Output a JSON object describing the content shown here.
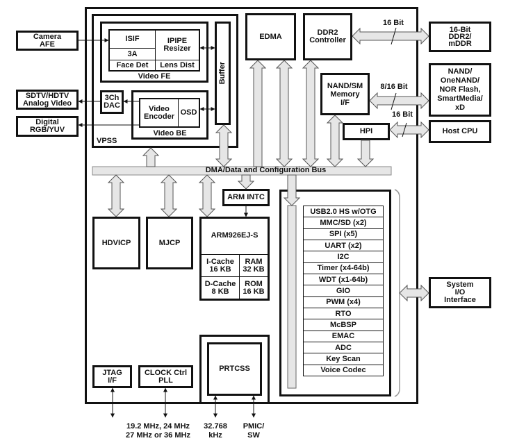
{
  "external_left": {
    "camera_afe": "Camera\nAFE",
    "sdtv_hdtv": "SDTV/HDTV\nAnalog Video",
    "digital_rgb": "Digital\nRGB/YUV"
  },
  "external_right": {
    "ddr_memory": "16-Bit\nDDR2/\nmDDR",
    "nand_flash": "NAND/\nOneNAND/\nNOR Flash,\nSmartMedia/\nxD",
    "host_cpu": "Host CPU",
    "system_io": "System\nI/O\nInterface"
  },
  "vpss": {
    "label": "VPSS",
    "video_fe": {
      "label": "Video FE",
      "isif": "ISIF",
      "three_a": "3A",
      "face_det": "Face Det",
      "ipipe": "IPIPE\nResizer",
      "lens_dist": "Lens Dist"
    },
    "buffer": "Buffer",
    "dac": "3Ch\nDAC",
    "video_be": {
      "label": "Video BE",
      "encoder": "Video\nEncoder",
      "osd": "OSD"
    }
  },
  "edma": "EDMA",
  "ddr2_controller": "DDR2\nController",
  "nand_sm": "NAND/SM\nMemory\nI/F",
  "hpi": "HPI",
  "bus_widths": {
    "ddr": "16 Bit",
    "nand": "8/16 Bit",
    "hpi": "16 Bit"
  },
  "bus": "DMA/Data and Configuration Bus",
  "arm_intc": "ARM INTC",
  "hdvicp": "HDVICP",
  "mjcp": "MJCP",
  "arm": {
    "core": "ARM926EJ-S",
    "icache": "I-Cache\n16 KB",
    "ram": "RAM\n32 KB",
    "dcache": "D-Cache\n8 KB",
    "rom": "ROM\n16 KB"
  },
  "peripherals": [
    "USB2.0 HS w/OTG",
    "MMC/SD (x2)",
    "SPI (x5)",
    "UART (x2)",
    "I2C",
    "Timer (x4-64b)",
    "WDT (x1-64b)",
    "GIO",
    "PWM (x4)",
    "RTO",
    "McBSP",
    "EMAC",
    "ADC",
    "Key Scan",
    "Voice Codec"
  ],
  "jtag": "JTAG\nI/F",
  "clock": "CLOCK Ctrl\nPLL",
  "prtcss": "PRTCSS",
  "bottom_labels": {
    "clock_freqs": "19.2 MHz, 24 MHz\n27 MHz or 36 MHz",
    "rtc_freq": "32.768\nkHz",
    "pmic": "PMIC/\nSW"
  }
}
